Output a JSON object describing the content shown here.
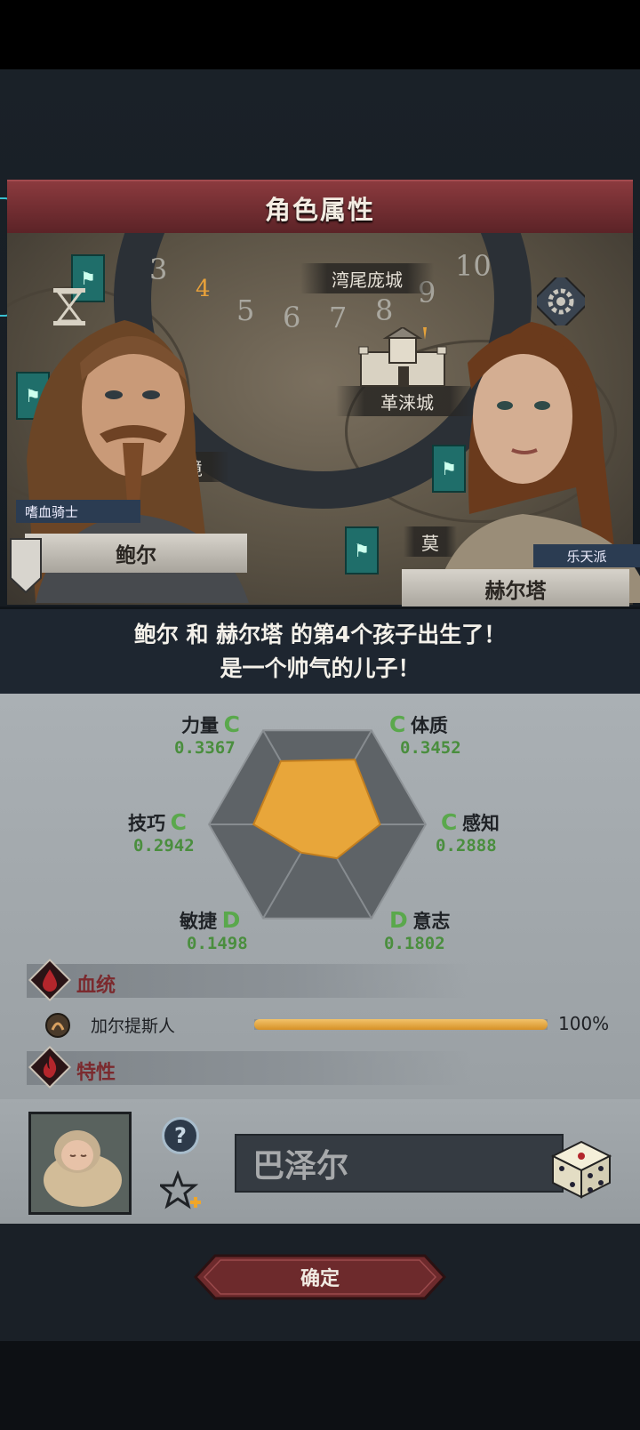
{
  "title": "角色属性",
  "map": {
    "wheel_numbers": [
      "3",
      "4",
      "5",
      "6",
      "7",
      "8",
      "9",
      "10"
    ],
    "active_number": "4",
    "places": [
      "湾尾庞城",
      "革涞城",
      "边境",
      "莫"
    ]
  },
  "father": {
    "name": "鲍尔",
    "trait_tag": "嗜血骑士"
  },
  "mother": {
    "name": "赫尔塔",
    "trait_tag": "乐天派"
  },
  "announcement": {
    "line1": "鲍尔 和 赫尔塔 的第4个孩子出生了！",
    "line2": "是一个帅气的儿子！"
  },
  "stats": [
    {
      "name": "力量",
      "grade": "C",
      "value": "0.3367",
      "level": 0.3367
    },
    {
      "name": "体质",
      "grade": "C",
      "value": "0.3452",
      "level": 0.3452
    },
    {
      "name": "感知",
      "grade": "C",
      "value": "0.2888",
      "level": 0.2888
    },
    {
      "name": "意志",
      "grade": "D",
      "value": "0.1802",
      "level": 0.1802
    },
    {
      "name": "敏捷",
      "grade": "D",
      "value": "0.1498",
      "level": 0.1498
    },
    {
      "name": "技巧",
      "grade": "C",
      "value": "0.2942",
      "level": 0.2942
    }
  ],
  "bloodline": {
    "section_title": "血统",
    "entries": [
      {
        "name": "加尔提斯人",
        "percent_label": "100%",
        "fraction": 1.0
      }
    ]
  },
  "traits": {
    "section_title": "特性"
  },
  "child": {
    "name": "巴泽尔"
  },
  "confirm_label": "确定",
  "colors": {
    "title_bar": "#7a3034",
    "stat_polygon": "#e8a63a",
    "grade_green": "#5aa84c",
    "bloodline_bar": "#e3a33a"
  }
}
